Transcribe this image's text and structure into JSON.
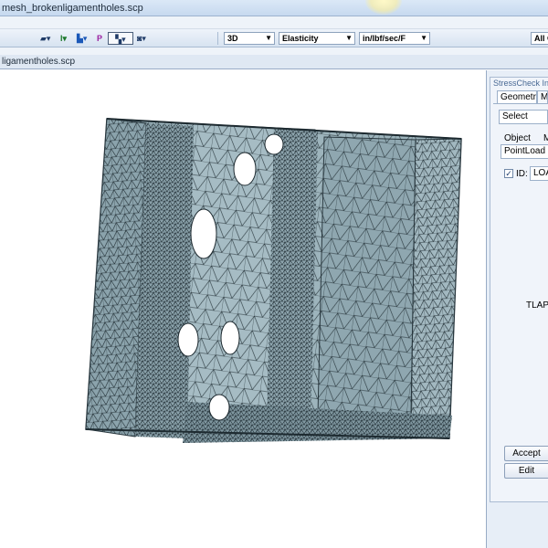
{
  "window": {
    "title": "mesh_brokenligamentholes.scp"
  },
  "toolbar": {
    "view_combo": "3D",
    "analysis_combo": "Elasticity",
    "units_combo": "in/lbf/sec/F",
    "filter_combo": "All C",
    "icon_label_p": "P"
  },
  "document_tab": {
    "label": "ligamentholes.scp"
  },
  "panel": {
    "title": "StressCheck Input",
    "tabs": [
      "Geometry",
      "Mo"
    ],
    "action_select": "Select",
    "object_label": "Object",
    "method_label": "M",
    "object_value": "PointLoad ,T",
    "id_label": "ID:",
    "id_checked": true,
    "id_value": "LOA",
    "tlap_text": "TLAP C",
    "accept_button": "Accept",
    "edit_button": "Edit"
  },
  "colors": {
    "mesh_fill": "#9db4bc",
    "mesh_dark": "#7f969f",
    "mesh_lines": "#1d2a30",
    "panel_bg": "#f0f4fa",
    "toolbar_bg": "#dbe6f3"
  }
}
